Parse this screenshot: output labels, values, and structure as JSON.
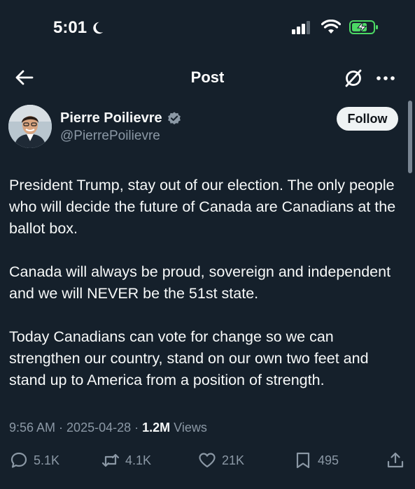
{
  "status_bar": {
    "time": "5:01"
  },
  "header": {
    "title": "Post"
  },
  "author": {
    "name": "Pierre Poilievre",
    "handle": "@PierrePoilievre",
    "follow_label": "Follow"
  },
  "post": {
    "paragraphs": [
      "President Trump, stay out of our election. The only people who will decide the future of Canada are Canadians at the ballot box.",
      "Canada will always be proud, sovereign and independent and we will NEVER be the 51st state.",
      "Today Canadians can vote for change so we can strengthen our country, stand on our own two feet and stand up to America from a position of strength."
    ],
    "time": "9:56 AM",
    "date": "2025-04-28",
    "separator": " · ",
    "views_count": "1.2M",
    "views_label": "Views"
  },
  "actions": {
    "replies": "5.1K",
    "reposts": "4.1K",
    "likes": "21K",
    "bookmarks": "495"
  },
  "colors": {
    "background": "#15202b",
    "text": "#f7f9f9",
    "muted": "#8b98a5",
    "verified": "#8b98a5",
    "battery": "#4cd964"
  }
}
